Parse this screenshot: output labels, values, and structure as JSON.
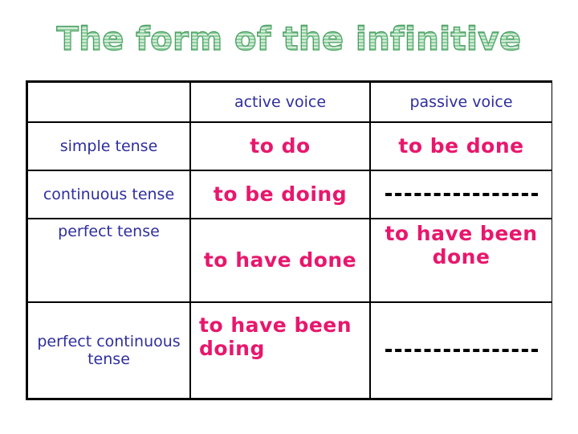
{
  "slide": {
    "title": "The form of the infinitive",
    "title_color": "#4c9e63",
    "label_color": "#2e2e9e",
    "verb_color": "#e8176c",
    "border_color": "#000000",
    "background": "#ffffff"
  },
  "table": {
    "headers": {
      "corner": "",
      "active": "active voice",
      "passive": "passive voice"
    },
    "rows": [
      {
        "label": "simple tense",
        "active": "to do",
        "passive": "to be done"
      },
      {
        "label": "continuous tense",
        "active": "to be doing",
        "passive": "—————"
      },
      {
        "label": "perfect tense",
        "active": "to have done",
        "passive": "to have been done"
      },
      {
        "label": "perfect continuous tense",
        "active": "to have been doing",
        "passive": "—————"
      }
    ]
  }
}
